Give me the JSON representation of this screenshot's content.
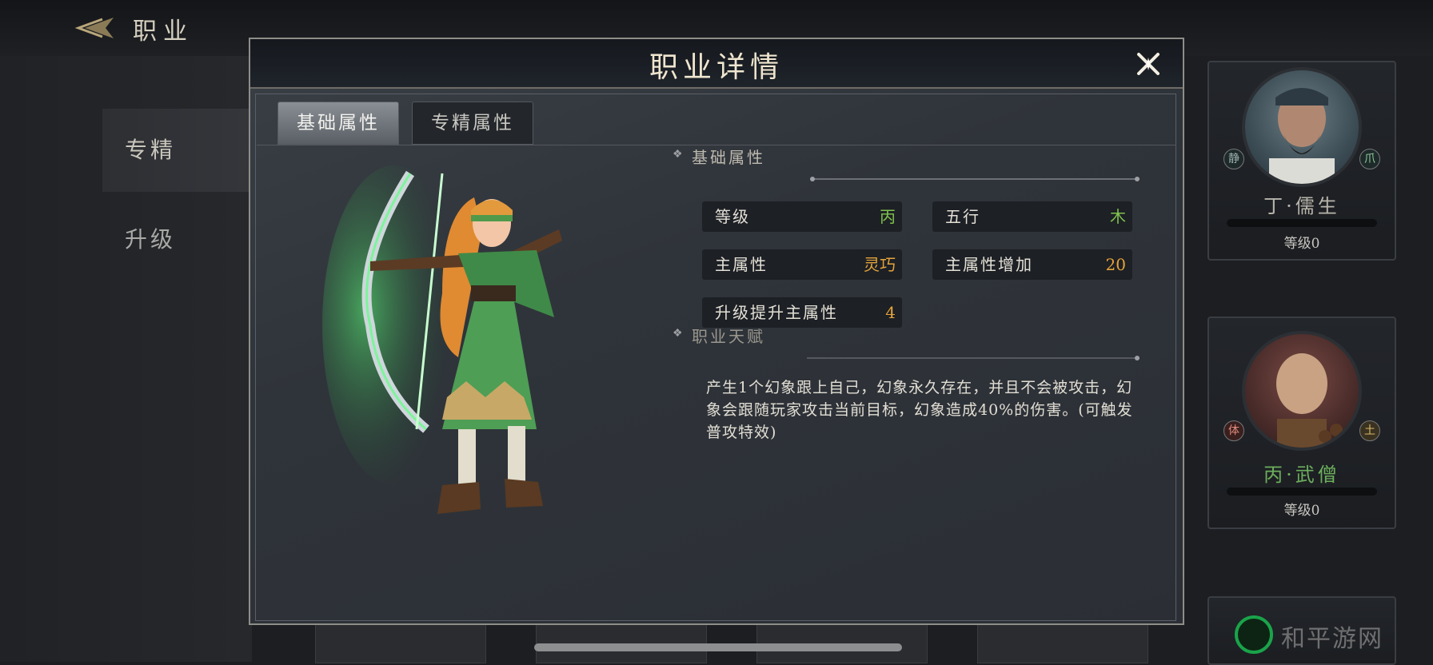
{
  "page": {
    "title": "职业"
  },
  "sidebar": {
    "items": [
      {
        "label": "专精"
      },
      {
        "label": "升级"
      }
    ]
  },
  "modal": {
    "title": "职业详情",
    "tabs": [
      {
        "label": "基础属性"
      },
      {
        "label": "专精属性"
      }
    ],
    "basic_section_title": "基础属性",
    "stats": [
      {
        "label": "等级",
        "value": "丙"
      },
      {
        "label": "五行",
        "value": "木"
      },
      {
        "label": "主属性",
        "value": "灵巧"
      },
      {
        "label": "主属性增加",
        "value": "20"
      },
      {
        "label": "升级提升主属性",
        "value": "4"
      }
    ],
    "talent_section_title": "职业天赋",
    "talent_text": "产生1个幻象跟上自己，幻象永久存在，并且不会被攻击，幻象会跟随玩家攻击当前目标，幻象造成40%的伤害。(可触发普攻特效)"
  },
  "roster": {
    "cards": [
      {
        "name": "丁·儒生",
        "level": "等级0",
        "badge_left": "静",
        "badge_right": "爪"
      },
      {
        "name": "丙·武僧",
        "level": "等级0",
        "badge_left": "体",
        "badge_right": "土"
      }
    ]
  },
  "watermark": {
    "text": "和平游网"
  },
  "colors": {
    "green_value": "#7fc24e",
    "gold_value": "#e5a43a",
    "accent_green": "#1aa34a"
  }
}
